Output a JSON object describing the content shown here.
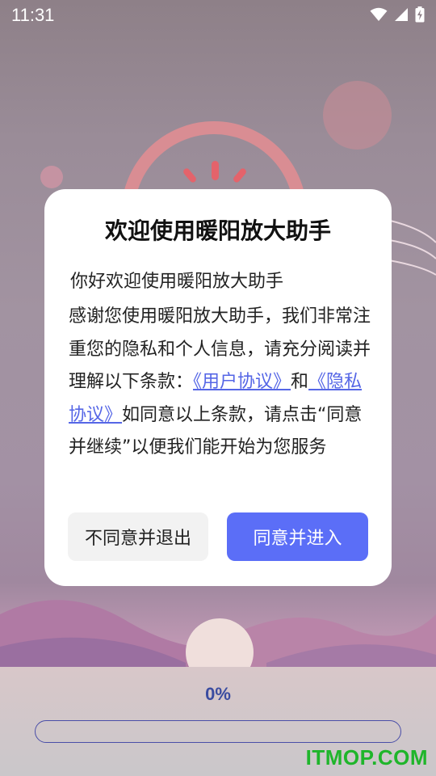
{
  "status_bar": {
    "time": "11:31",
    "icons": [
      "wifi-icon",
      "signal-icon",
      "battery-charging-icon"
    ]
  },
  "dialog": {
    "title": "欢迎使用暖阳放大助手",
    "greeting": "你好欢迎使用暖阳放大助手",
    "body_intro": "感谢您使用暖阳放大助手，我们非常注重您的隐私和个人信息，请充分阅读并理解以下条款：",
    "user_agreement_link": "《用户协议》",
    "conjunction": "和",
    "privacy_policy_link": "《隐私协议》",
    "body_outro": "如同意以上条款，请点击“同意并继续”以便我们能开始为您服务",
    "decline_label": "不同意并退出",
    "accept_label": "同意并进入"
  },
  "progress": {
    "label": "0%",
    "value": 0
  },
  "watermark": "ITMOP.COM",
  "colors": {
    "accent": "#5b6ef7",
    "link": "#5566e6",
    "progress_text": "#3a4ca0",
    "watermark": "#1fb52b"
  }
}
